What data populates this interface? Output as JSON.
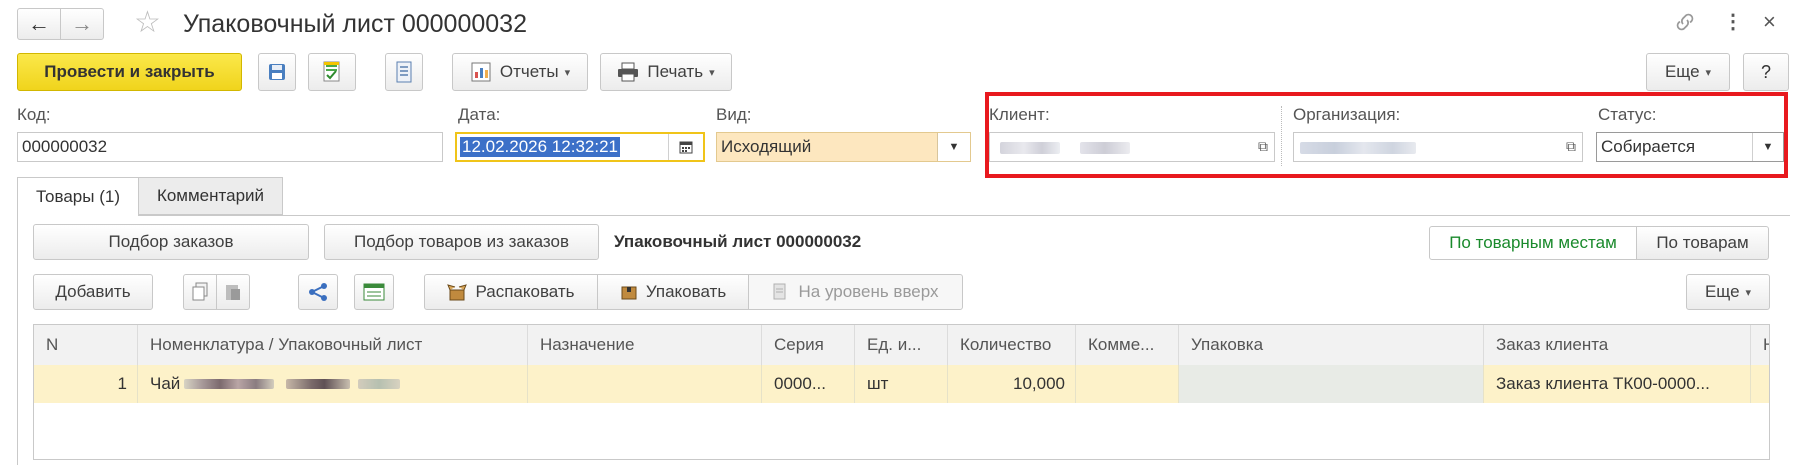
{
  "window": {
    "title": "Упаковочный лист 000000032"
  },
  "toolbar": {
    "post_close": "Провести и закрыть",
    "reports": "Отчеты",
    "print": "Печать",
    "more": "Еще",
    "help": "?"
  },
  "fields": {
    "code_label": "Код:",
    "code_value": "000000032",
    "date_label": "Дата:",
    "date_value": "12.02.2026 12:32:21",
    "kind_label": "Вид:",
    "kind_value": "Исходящий",
    "client_label": "Клиент:",
    "org_label": "Организация:",
    "status_label": "Статус:",
    "status_value": "Собирается"
  },
  "tabs": [
    {
      "label": "Товары (1)"
    },
    {
      "label": "Комментарий"
    }
  ],
  "goods": {
    "select_orders": "Подбор заказов",
    "select_goods": "Подбор товаров из заказов",
    "caption": "Упаковочный лист 000000032",
    "by_places": "По товарным местам",
    "by_goods": "По товарам",
    "add": "Добавить",
    "unpack": "Распаковать",
    "pack": "Упаковать",
    "level_up": "На уровень вверх",
    "more": "Еще"
  },
  "table": {
    "columns": [
      "N",
      "Номенклатура / Упаковочный лист",
      "Назначение",
      "Серия",
      "Ед. и...",
      "Количество",
      "Комме...",
      "Упаковка",
      "Заказ клиента",
      "Н"
    ],
    "rows": [
      {
        "n": "1",
        "item": "Чай",
        "purpose": "",
        "series": "0000...",
        "unit": "шт",
        "qty": "10,000",
        "comment": "",
        "package": "",
        "order": "Заказ клиента ТК00-0000..."
      }
    ]
  },
  "colors": {
    "accent_yellow": "#f5df2a",
    "highlight_red": "#e8191e",
    "row_selected": "#fdf2c9",
    "green_text": "#1a8a2c"
  }
}
